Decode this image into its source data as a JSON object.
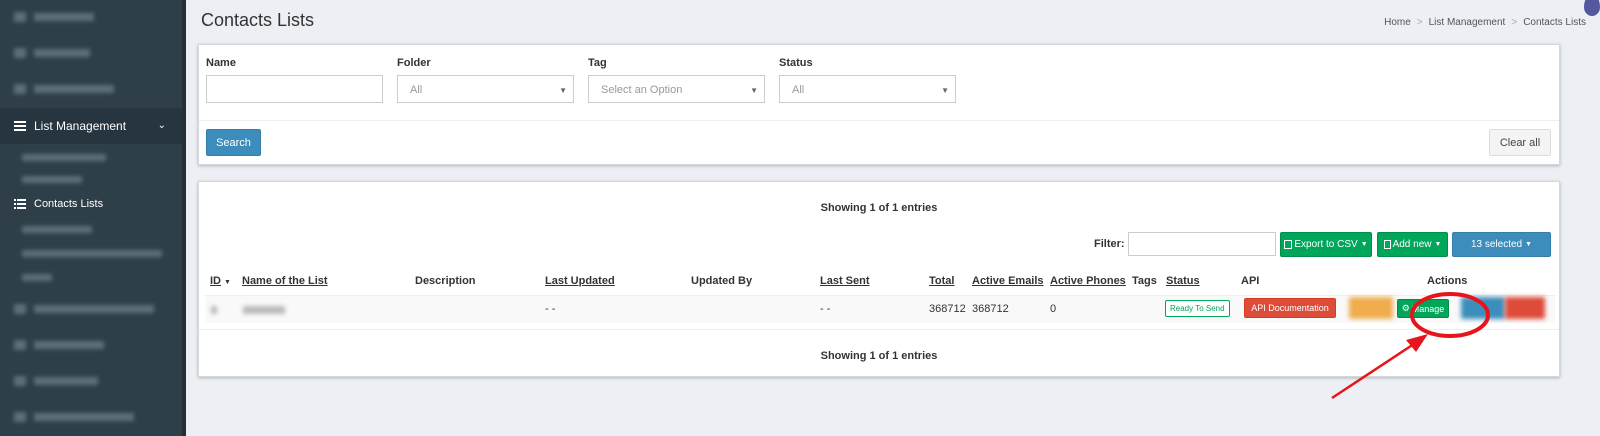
{
  "sidebar": {
    "active_section": "List Management",
    "current_item": "Contacts Lists"
  },
  "header": {
    "title": "Contacts Lists",
    "breadcrumb": [
      "Home",
      "List Management",
      "Contacts Lists"
    ]
  },
  "search_form": {
    "name_label": "Name",
    "name_value": "",
    "folder_label": "Folder",
    "folder_value": "All",
    "tag_label": "Tag",
    "tag_placeholder": "Select an Option",
    "status_label": "Status",
    "status_value": "All",
    "search_button": "Search",
    "clear_button": "Clear all"
  },
  "table": {
    "showing_top": "Showing 1 of 1 entries",
    "showing_bottom": "Showing 1 of 1 entries",
    "filter_label": "Filter:",
    "export_button": "Export to CSV",
    "add_button": "Add new",
    "selected_button": "13 selected",
    "columns": [
      "ID",
      "Name of the List",
      "Description",
      "Last Updated",
      "Updated By",
      "Last Sent",
      "Total",
      "Active Emails",
      "Active Phones",
      "Tags",
      "Status",
      "API",
      "Actions"
    ],
    "row": {
      "last_updated": "- -",
      "last_sent": "- -",
      "total": "368712",
      "active_emails": "368712",
      "active_phones": "0",
      "status": "Ready To Send",
      "api_button": "API Documentation",
      "manage_button": "Manage"
    }
  },
  "colors": {
    "sidebar_bg": "#2f3f49",
    "primary": "#3c8dbc",
    "success": "#00a65a",
    "danger": "#dd4b39",
    "annotation": "#e8141c"
  }
}
